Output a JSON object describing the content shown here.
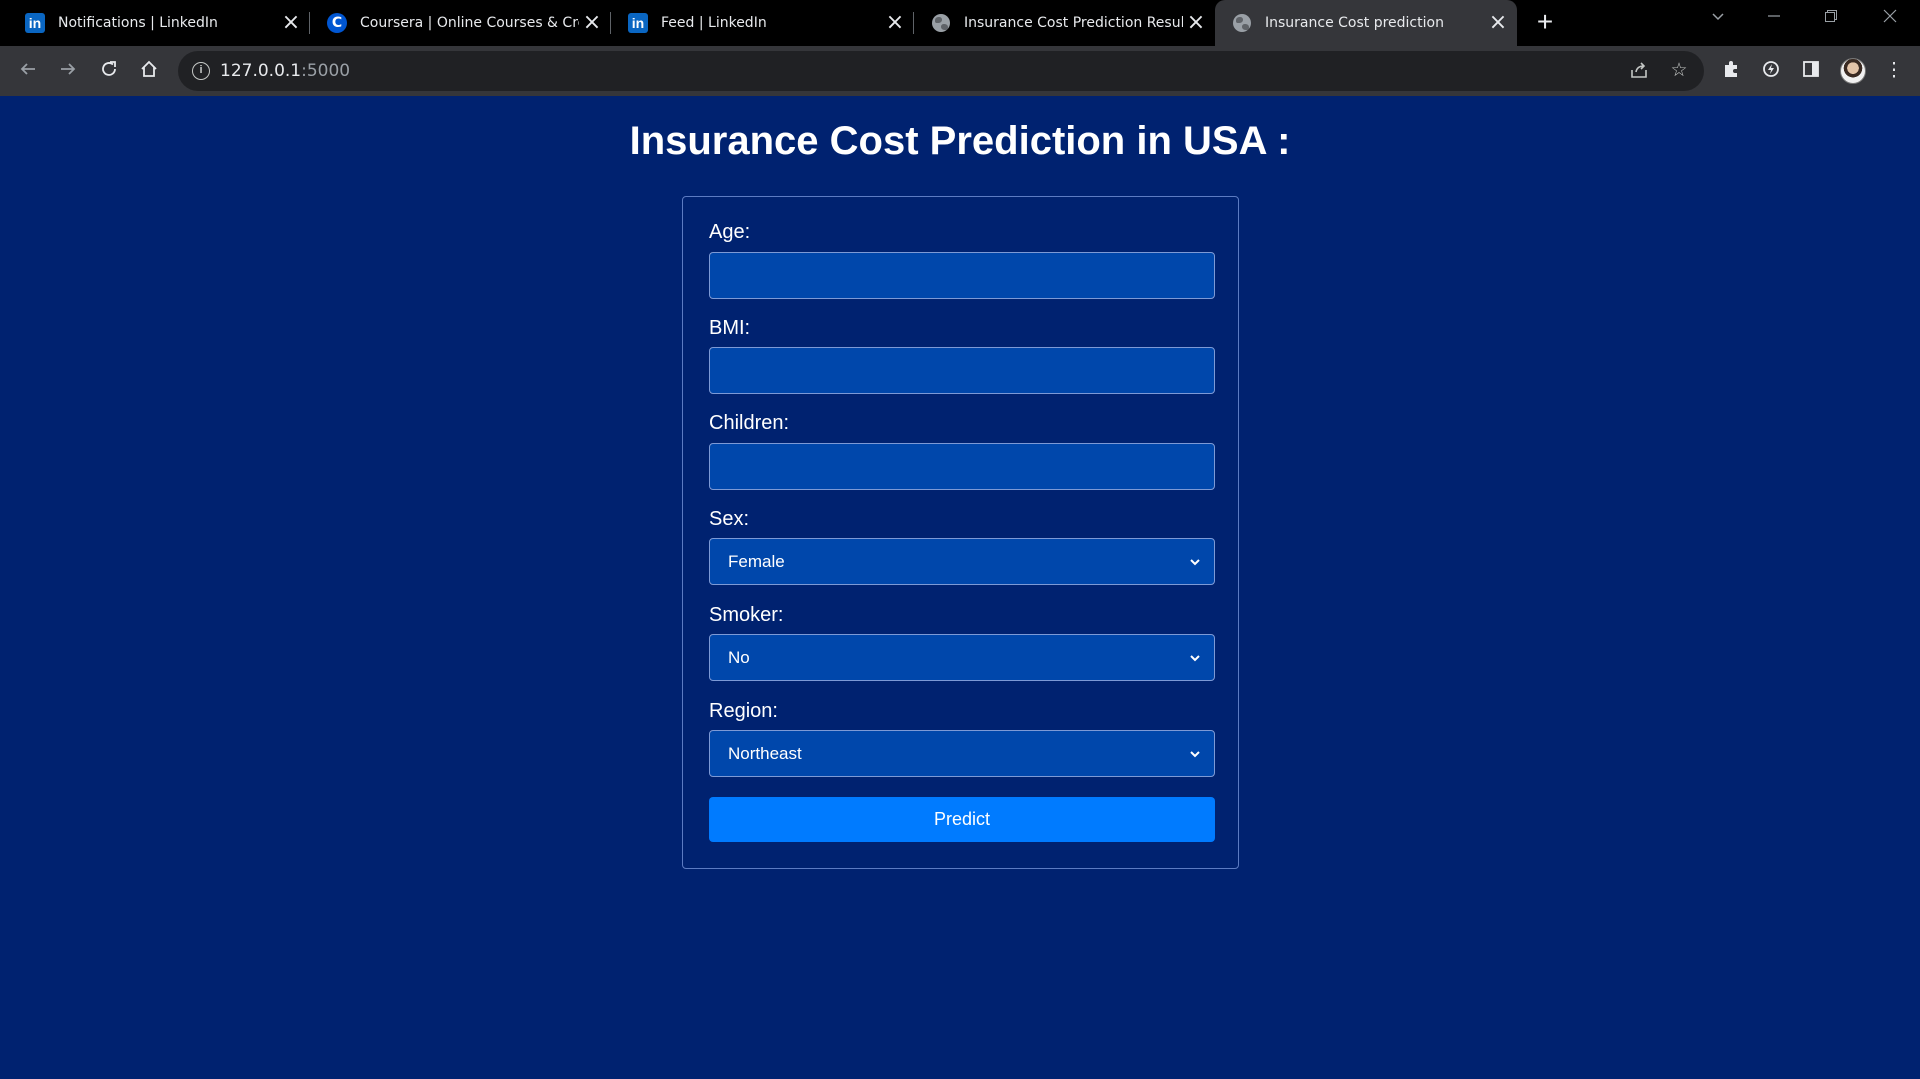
{
  "browser": {
    "tabs": [
      {
        "title": "Notifications | LinkedIn",
        "favicon": "linkedin-icon"
      },
      {
        "title": "Coursera | Online Courses & Credentials",
        "favicon": "coursera-icon"
      },
      {
        "title": "Feed | LinkedIn",
        "favicon": "linkedin-icon"
      },
      {
        "title": "Insurance Cost Prediction Result",
        "favicon": "globe-icon"
      },
      {
        "title": "Insurance Cost prediction",
        "favicon": "globe-icon",
        "active": true
      }
    ],
    "address": {
      "host": "127.0.0.1",
      "port": ":5000"
    }
  },
  "page": {
    "title": "Insurance Cost Prediction in USA :",
    "fields": {
      "age": {
        "label": "Age:",
        "value": ""
      },
      "bmi": {
        "label": "BMI:",
        "value": ""
      },
      "children": {
        "label": "Children:",
        "value": ""
      },
      "sex": {
        "label": "Sex:",
        "selected": "Female"
      },
      "smoker": {
        "label": "Smoker:",
        "selected": "No"
      },
      "region": {
        "label": "Region:",
        "selected": "Northeast"
      }
    },
    "submit_label": "Predict"
  },
  "colors": {
    "page_background": "#002270",
    "input_background": "#0047ab",
    "button": "#007bff",
    "text": "#ffffff"
  }
}
